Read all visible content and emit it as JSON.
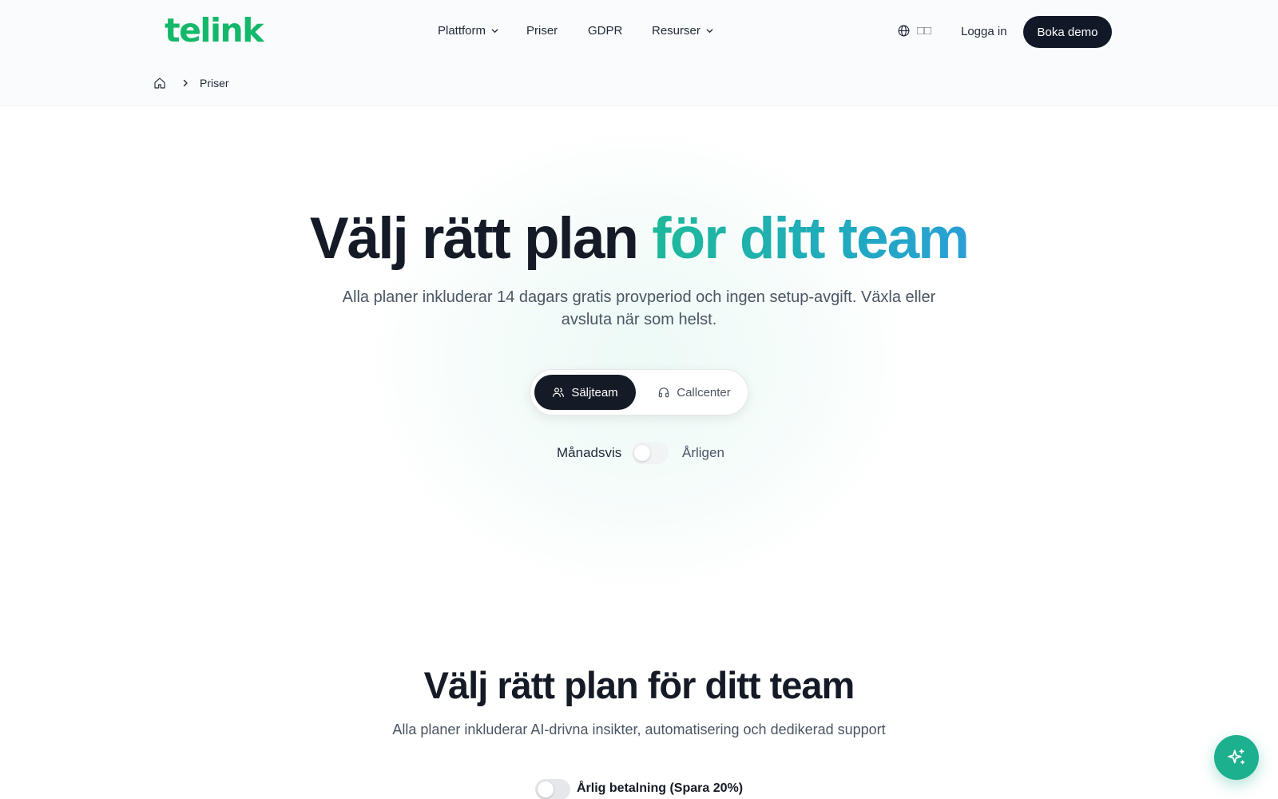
{
  "header": {
    "logo": "telink",
    "nav": [
      {
        "label": "Plattform",
        "has_dropdown": true
      },
      {
        "label": "Priser",
        "has_dropdown": false
      },
      {
        "label": "GDPR",
        "has_dropdown": false
      },
      {
        "label": "Resurser",
        "has_dropdown": true
      }
    ],
    "language_glyph": "□□",
    "login_label": "Logga in",
    "demo_label": "Boka demo"
  },
  "breadcrumb": {
    "current": "Priser"
  },
  "hero": {
    "title_plain": "Välj rätt plan ",
    "title_accent": "för ditt team",
    "subtitle": "Alla planer inkluderar 14 dagars gratis provperiod och ingen setup-avgift. Växla eller avsluta när som helst.",
    "segment": {
      "options": [
        "Säljteam",
        "Callcenter"
      ],
      "selected": "Säljteam"
    },
    "billing": {
      "monthly_label": "Månadsvis",
      "yearly_label": "Årligen",
      "yearly_enabled": false
    }
  },
  "plans_section": {
    "title": "Välj rätt plan för ditt team",
    "subtitle": "Alla planer inkluderar AI-drivna insikter, automatisering och dedikerad support",
    "annual_toggle_label": "Årlig betalning (Spara 20%)",
    "annual_enabled": false
  },
  "colors": {
    "brand": "#14b86a",
    "accent_start": "#1db99a",
    "accent_end": "#2aa0d6",
    "dark": "#151b26",
    "fab": "#1db08e"
  },
  "icons": {
    "fab": "sparkles-icon",
    "home": "home-icon",
    "language": "globe-icon"
  }
}
